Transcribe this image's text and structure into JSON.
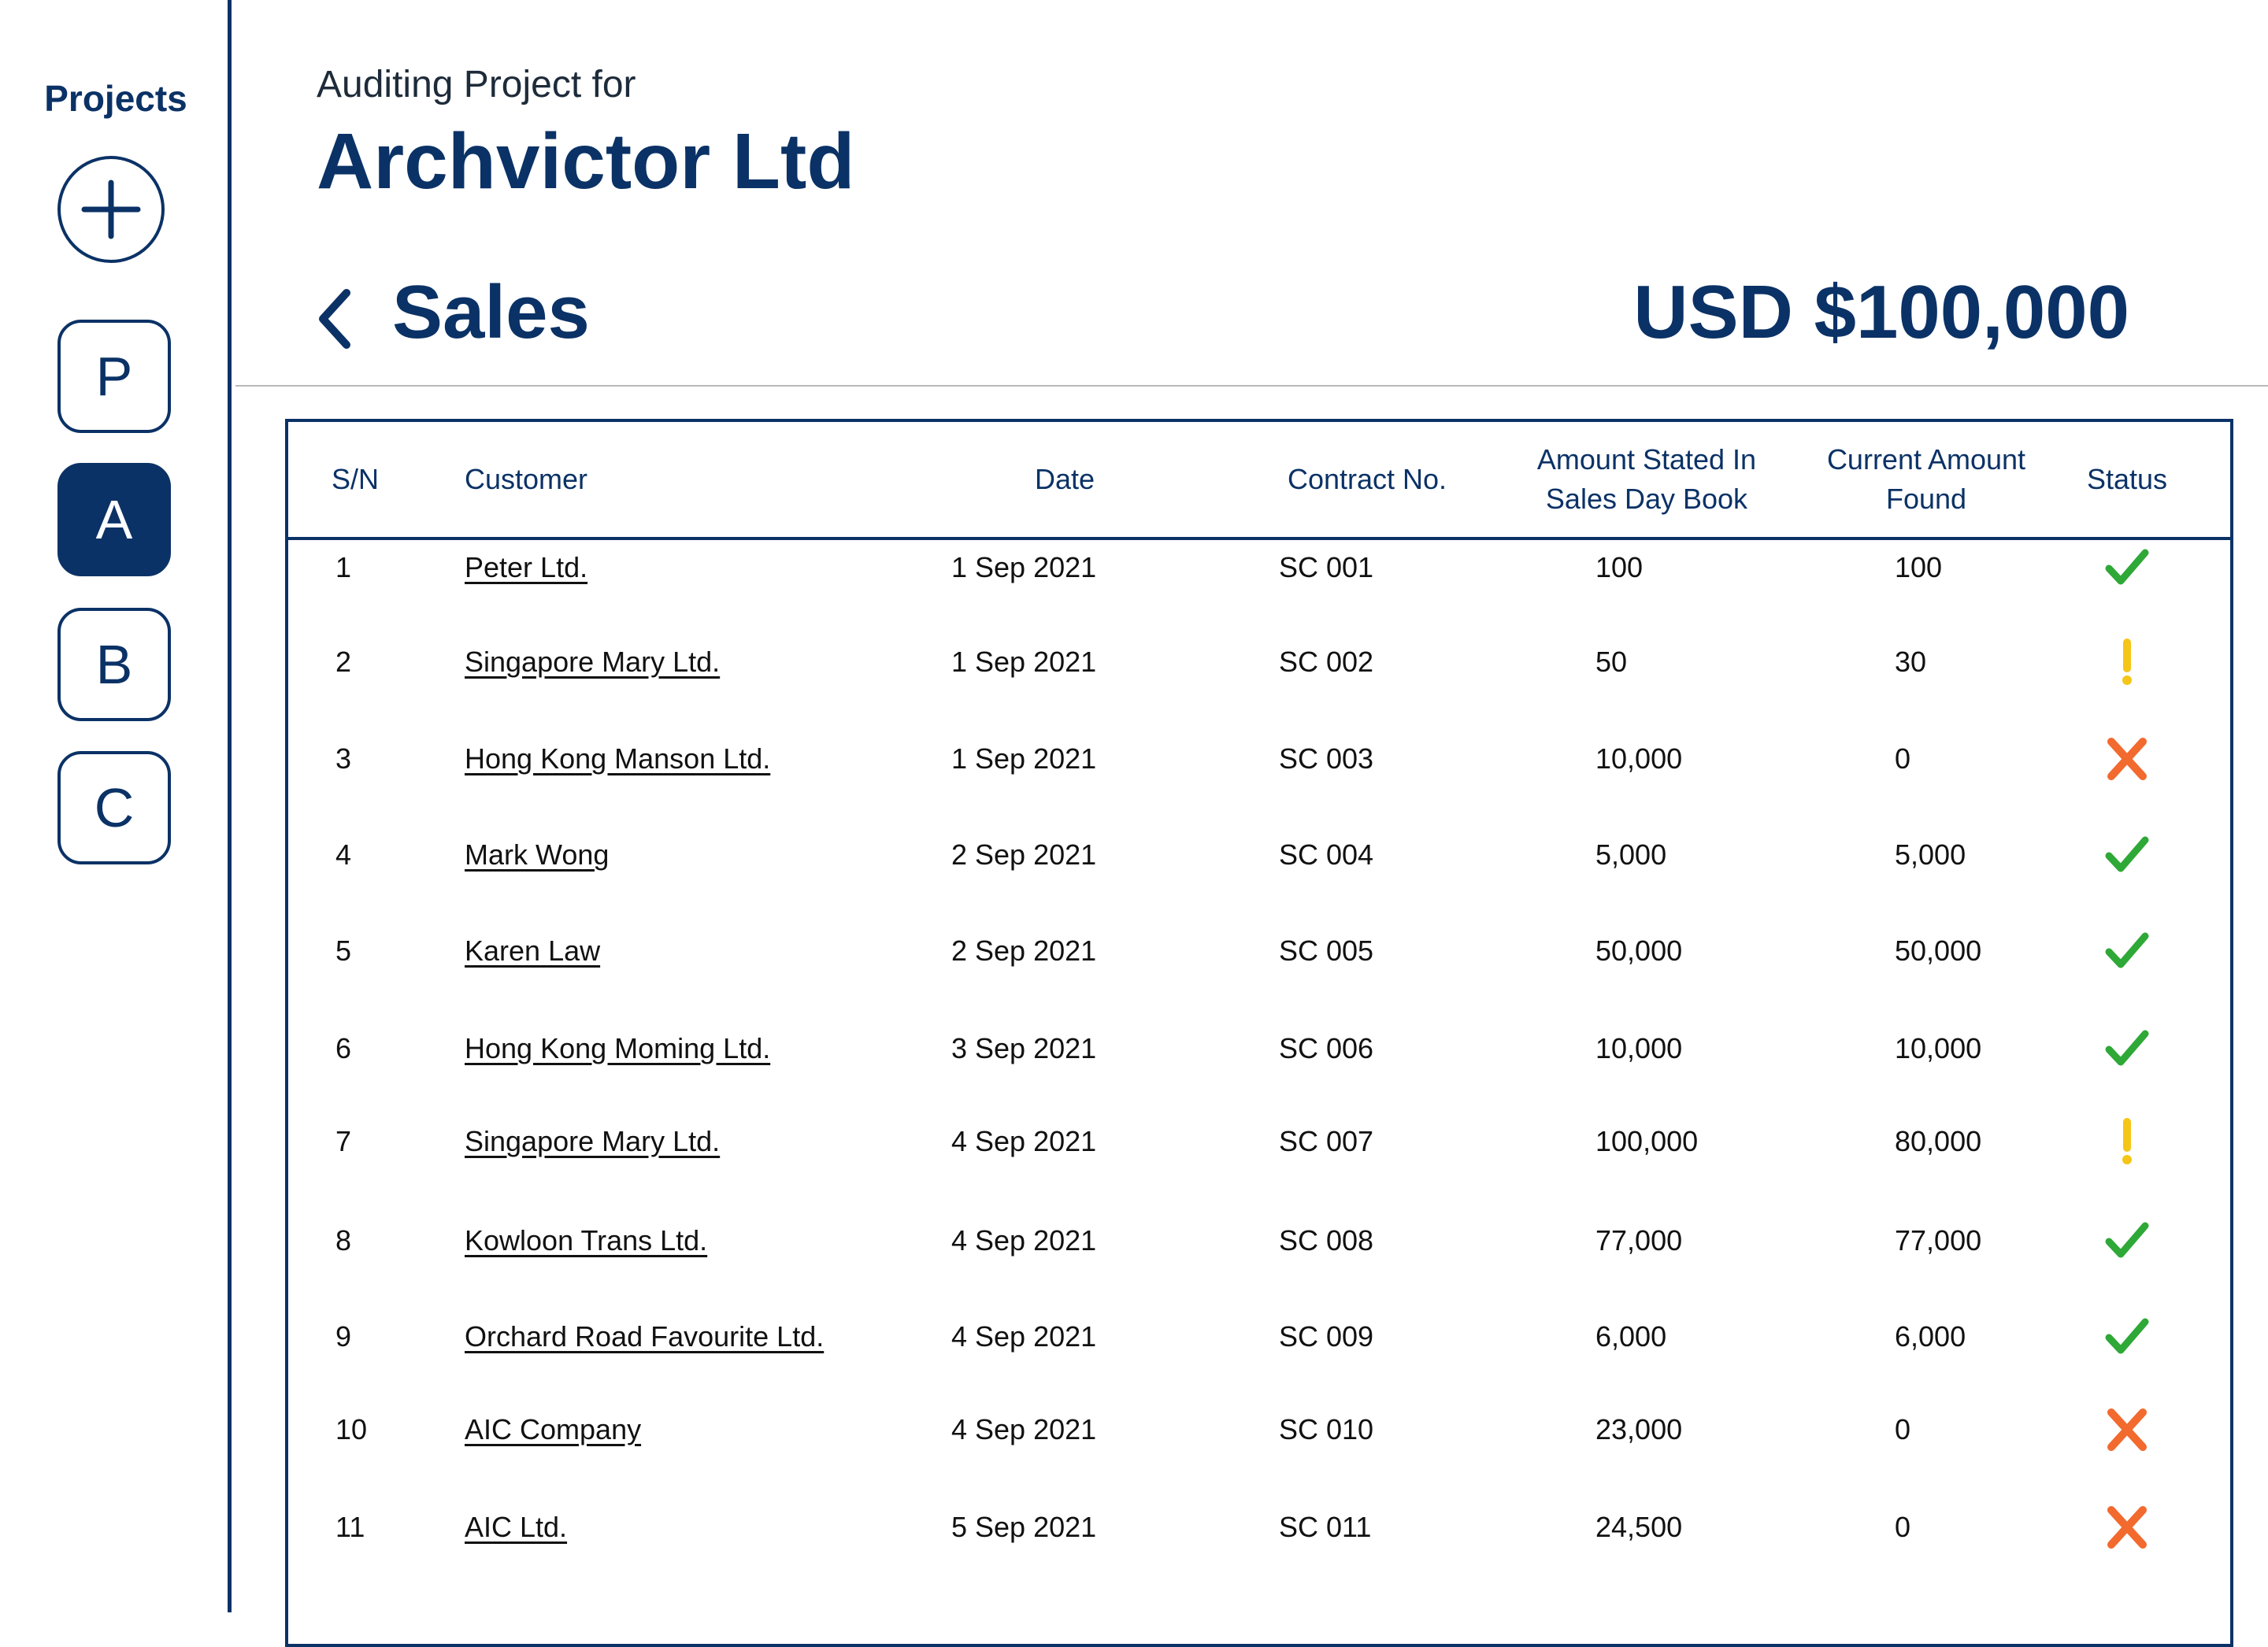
{
  "sidebar": {
    "title": "Projects",
    "add_icon": "plus-icon",
    "projects": [
      {
        "label": "P",
        "active": false
      },
      {
        "label": "A",
        "active": true
      },
      {
        "label": "B",
        "active": false
      },
      {
        "label": "C",
        "active": false
      }
    ]
  },
  "header": {
    "subtitle": "Auditing Project for",
    "company": "Archvictor Ltd",
    "back_icon": "chevron-left-icon",
    "section": "Sales",
    "total": "USD $100,000"
  },
  "table": {
    "columns": [
      "S/N",
      "Customer",
      "Date",
      "Contract No.",
      "Amount Stated In\nSales Day Book",
      "Current Amount\nFound",
      "Status"
    ],
    "rows": [
      {
        "sn": "1",
        "customer": "Peter Ltd.",
        "date": "1 Sep 2021",
        "contract": "SC 001",
        "stated": "100",
        "found": "100",
        "status": "ok"
      },
      {
        "sn": "2",
        "customer": "Singapore Mary Ltd.",
        "date": "1 Sep 2021",
        "contract": "SC 002",
        "stated": "50",
        "found": "30",
        "status": "warn"
      },
      {
        "sn": "3",
        "customer": "Hong Kong Manson Ltd.",
        "date": "1 Sep 2021",
        "contract": "SC 003",
        "stated": "10,000",
        "found": "0",
        "status": "fail"
      },
      {
        "sn": "4",
        "customer": "Mark Wong",
        "date": "2 Sep 2021",
        "contract": "SC 004",
        "stated": "5,000",
        "found": "5,000",
        "status": "ok"
      },
      {
        "sn": "5",
        "customer": "Karen Law",
        "date": "2 Sep 2021",
        "contract": "SC 005",
        "stated": "50,000",
        "found": "50,000",
        "status": "ok"
      },
      {
        "sn": "6",
        "customer": "Hong Kong Moming Ltd.",
        "date": "3 Sep 2021",
        "contract": "SC 006",
        "stated": "10,000",
        "found": "10,000",
        "status": "ok"
      },
      {
        "sn": "7",
        "customer": "Singapore Mary Ltd.",
        "date": "4 Sep 2021",
        "contract": "SC 007",
        "stated": "100,000",
        "found": "80,000",
        "status": "warn"
      },
      {
        "sn": "8",
        "customer": "Kowloon Trans Ltd.",
        "date": "4 Sep 2021",
        "contract": "SC 008",
        "stated": "77,000",
        "found": "77,000",
        "status": "ok"
      },
      {
        "sn": "9",
        "customer": "Orchard Road Favourite Ltd.",
        "date": "4 Sep 2021",
        "contract": "SC 009",
        "stated": "6,000",
        "found": "6,000",
        "status": "ok"
      },
      {
        "sn": "10",
        "customer": "AIC Company",
        "date": "4 Sep 2021",
        "contract": "SC 010",
        "stated": "23,000",
        "found": "0",
        "status": "fail"
      },
      {
        "sn": "11",
        "customer": "AIC Ltd.",
        "date": "5 Sep 2021",
        "contract": "SC 011",
        "stated": "24,500",
        "found": "0",
        "status": "fail"
      }
    ]
  },
  "colors": {
    "primary": "#0b3266",
    "ok": "#2ea836",
    "warn": "#f5c518",
    "fail": "#f26a2e",
    "divider": "#b9b9b9"
  },
  "status_icons": {
    "ok": "check-icon",
    "warn": "exclamation-icon",
    "fail": "cross-icon"
  }
}
